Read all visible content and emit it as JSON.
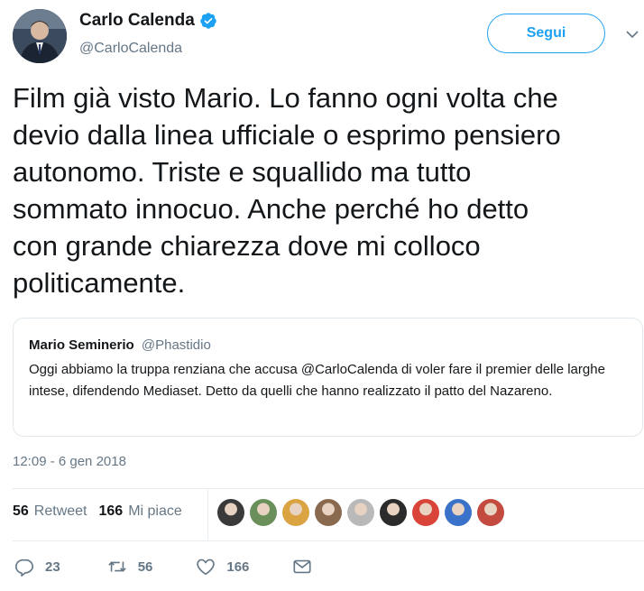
{
  "author": {
    "display_name": "Carlo Calenda",
    "handle": "@CarloCalenda",
    "verified": true
  },
  "follow_button": {
    "label": "Segui"
  },
  "tweet": {
    "text": "Film già visto Mario. Lo fanno ogni volta che\ndevio dalla linea ufficiale o esprimo pensiero\nautonomo. Triste e squallido ma tutto\nsommato innocuo. Anche perché ho detto\ncon grande chiarezza dove mi colloco\npoliticamente."
  },
  "quoted_tweet": {
    "author_name": "Mario Seminerio",
    "author_handle": "@Phastidio",
    "text": "Oggi abbiamo la truppa renziana che accusa @CarloCalenda di voler fare il premier delle larghe intese, difendendo Mediaset. Detto da quelli che hanno realizzato il patto del Nazareno."
  },
  "timestamp": "12:09 - 6 gen 2018",
  "stats": {
    "retweets_count": "56",
    "retweets_label": "Retweet",
    "likes_count": "166",
    "likes_label": "Mi piace"
  },
  "liker_avatar_colors": [
    "#3a3a3a",
    "#6b8f5a",
    "#d9a441",
    "#8a6a4e",
    "#b9b9b9",
    "#2b2b2b",
    "#d8433a",
    "#3a72c9",
    "#c24a3e"
  ],
  "actions": {
    "reply_count": "23",
    "retweet_count": "56",
    "like_count": "166"
  },
  "colors": {
    "accent": "#1da1f2",
    "secondary_text": "#657786",
    "border": "#e1e8ed"
  }
}
